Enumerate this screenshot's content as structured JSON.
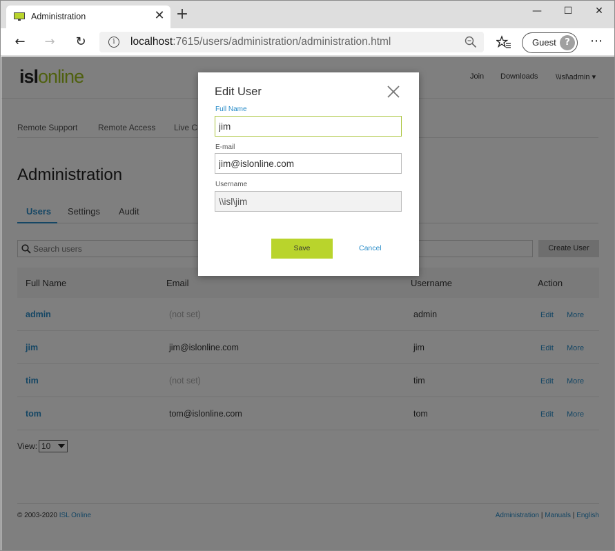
{
  "browser": {
    "tab_title": "Administration",
    "url_host": "localhost",
    "url_rest": ":7615/users/administration/administration.html",
    "profile_label": "Guest"
  },
  "header": {
    "logo_part1": "isl",
    "logo_part2": "online",
    "nav": [
      "Join",
      "Downloads",
      "\\\\isl\\admin ▾"
    ]
  },
  "product_nav": [
    "Remote Support",
    "Remote Access",
    "Live Ch"
  ],
  "page": {
    "title": "Administration",
    "tabs": [
      "Users",
      "Settings",
      "Audit"
    ]
  },
  "toolbar": {
    "search_placeholder": "Search users",
    "create_label": "Create User"
  },
  "table": {
    "columns": [
      "Full Name",
      "Email",
      "Username",
      "Action"
    ],
    "rows": [
      {
        "name": "admin",
        "email": "(not set)",
        "username": "admin",
        "edit": "Edit",
        "more": "More"
      },
      {
        "name": "jim",
        "email": "jim@islonline.com",
        "username": "jim",
        "edit": "Edit",
        "more": "More"
      },
      {
        "name": "tim",
        "email": "(not set)",
        "username": "tim",
        "edit": "Edit",
        "more": "More"
      },
      {
        "name": "tom",
        "email": "tom@islonline.com",
        "username": "tom",
        "edit": "Edit",
        "more": "More"
      }
    ]
  },
  "view": {
    "label": "View:",
    "value": "10"
  },
  "footer": {
    "copyright": "© 2003-2020",
    "brand_link": "ISL Online",
    "links": [
      "Administration",
      "Manuals",
      "English"
    ],
    "separator": " | "
  },
  "modal": {
    "title": "Edit User",
    "full_name_label": "Full Name",
    "full_name_value": "jim",
    "email_label": "E-mail",
    "email_value": "jim@islonline.com",
    "username_label": "Username",
    "username_value": "\\\\isl\\jim",
    "save_label": "Save",
    "cancel_label": "Cancel"
  },
  "colors": {
    "accent_green": "#b9d42c",
    "link_blue": "#2a8dc9",
    "overlay": "rgba(0,0,0,0.5)"
  }
}
